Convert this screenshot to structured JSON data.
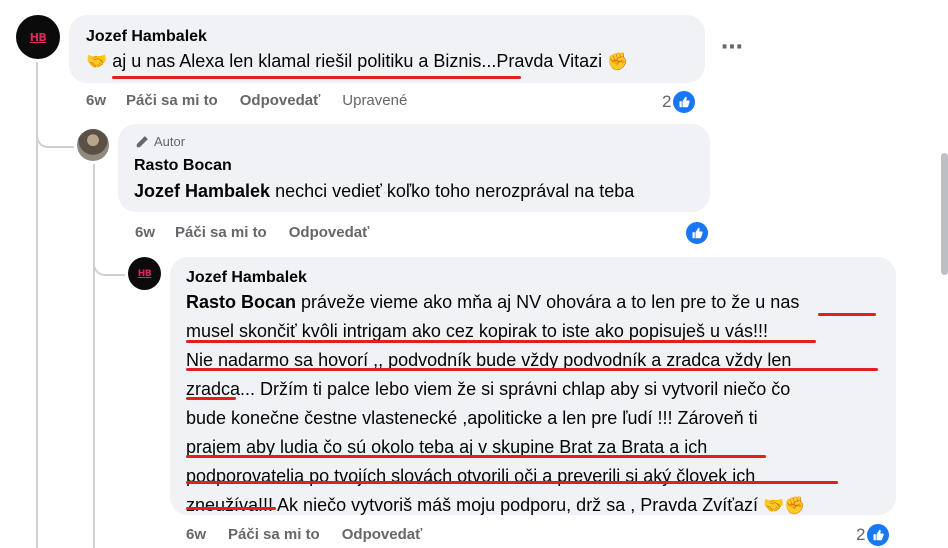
{
  "comments": [
    {
      "author": "Jozef Hambalek",
      "avatar_text": "HB",
      "text_prefix_emoji": "🤝",
      "text": "aj u nas Alexa len klamal riešil politiku a Biznis...Pravda Vitazi",
      "text_suffix_emoji": "✊",
      "age": "6w",
      "like_label": "Páči sa mi to",
      "reply_label": "Odpovedať",
      "edited_label": "Upravené",
      "reaction_count": "2",
      "more_icon": "⋯"
    },
    {
      "badge_label": "Autor",
      "author": "Rasto Bocan",
      "mention": "Jozef Hambalek",
      "text": "nechci vedieť koľko toho nerozprával na teba",
      "age": "6w",
      "like_label": "Páči sa mi to",
      "reply_label": "Odpovedať"
    },
    {
      "author": "Jozef Hambalek",
      "avatar_text": "HB",
      "mention": "Rasto Bocan",
      "lines": [
        "práveže vieme ako mňa aj NV ohovára a to len pre to že u nas",
        "musel skončiť kvôli intrigam ako cez kopirak to iste ako popisuješ u vás!!!",
        "Nie nadarmo sa hovorí ,, podvodník bude vždy podvodník a zradca vždy len",
        "zradca... Držím ti palce lebo viem že si správni chlap aby si vytvoril niečo čo",
        "bude konečne čestne vlastenecké ,apoliticke a len pre ľudí !!! Zároveň ti",
        "prajem aby ludia čo sú okolo teba aj v skupine Brat za Brata a ich",
        "podporovatelia po tvojích slovách otvorili oči a preverili si aký človek ich",
        "zneužíva!!! Ak niečo vytvoriš máš moju podporu, drž sa , Pravda Zvíťazí"
      ],
      "suffix_emoji": "🤝✊",
      "age": "6w",
      "like_label": "Páči sa mi to",
      "reply_label": "Odpovedať",
      "reaction_count": "2"
    }
  ],
  "colors": {
    "bubble": "#f0f2f5",
    "underline": "#e02020",
    "like_blue": "#1877f2"
  }
}
